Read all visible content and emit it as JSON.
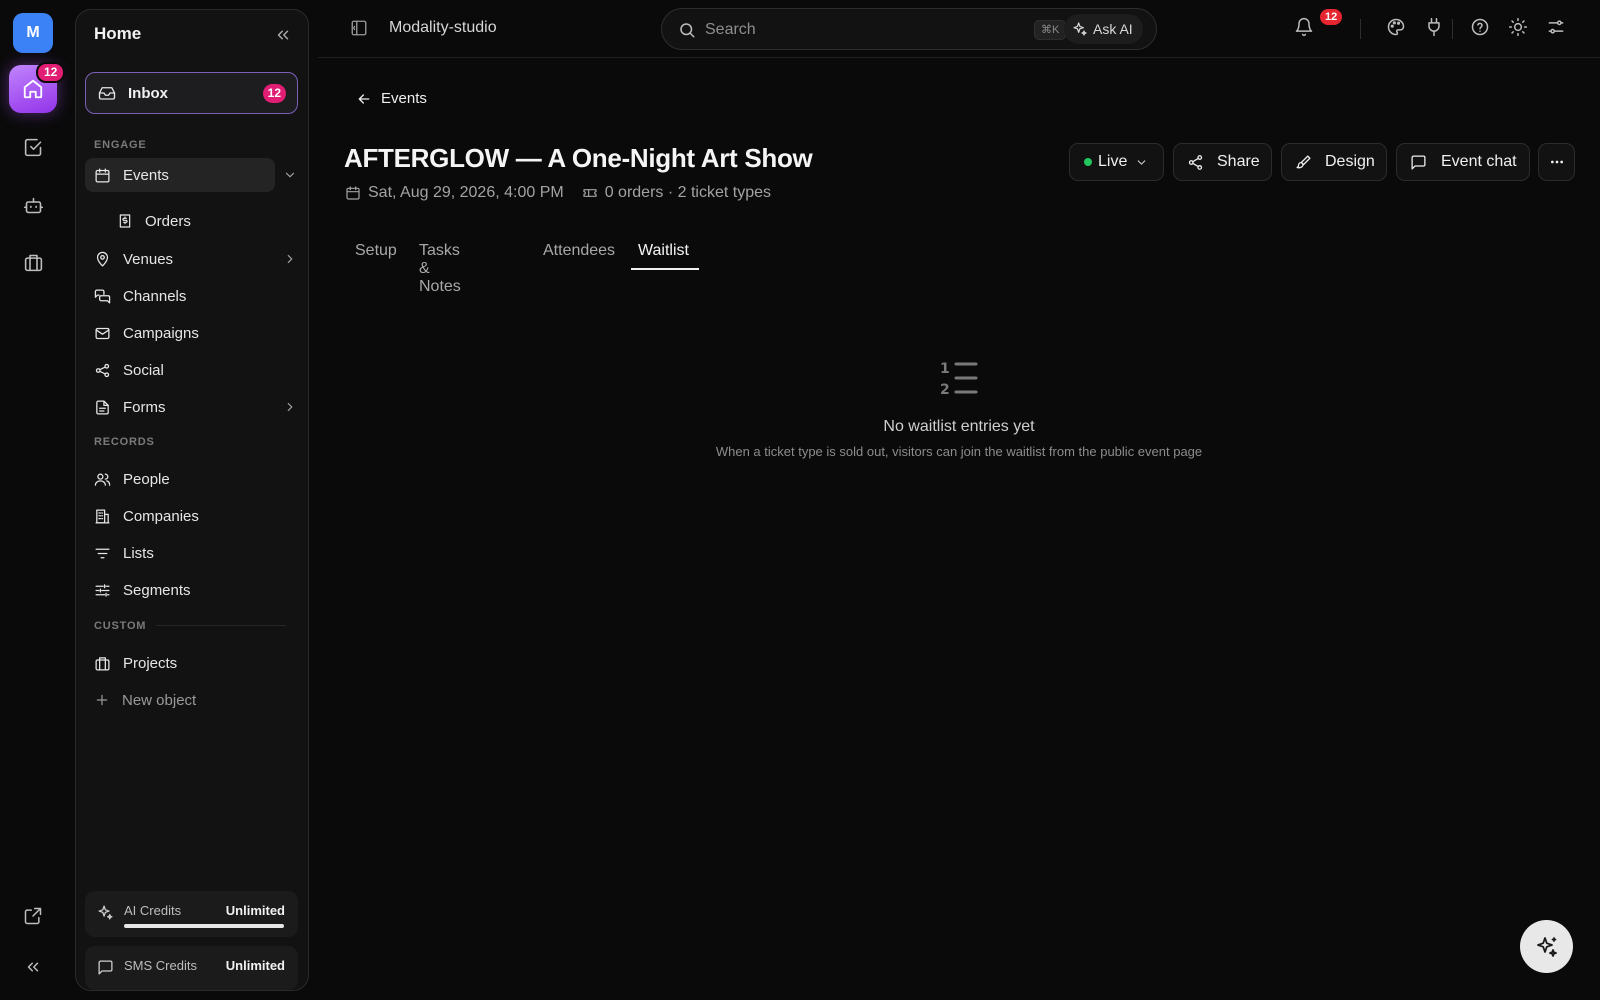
{
  "rail": {
    "avatar_letter": "M",
    "home_badge": "12"
  },
  "sidebar": {
    "title": "Home",
    "inbox": {
      "label": "Inbox",
      "count": "12"
    },
    "sections": {
      "engage": "ENGAGE",
      "records": "RECORDS",
      "custom": "CUSTOM"
    },
    "engage_items": {
      "events": "Events",
      "orders": "Orders",
      "venues": "Venues",
      "channels": "Channels",
      "campaigns": "Campaigns",
      "social": "Social",
      "forms": "Forms"
    },
    "records_items": {
      "people": "People",
      "companies": "Companies",
      "lists": "Lists",
      "segments": "Segments"
    },
    "custom_items": {
      "projects": "Projects",
      "new_object": "New object"
    },
    "credits": {
      "ai_label": "AI Credits",
      "ai_value": "Unlimited",
      "ai_fill": 1.0,
      "sms_label": "SMS Credits",
      "sms_value": "Unlimited"
    }
  },
  "topbar": {
    "workspace": "Modality-studio",
    "search_placeholder": "Search",
    "shortcut": "⌘K",
    "ask_ai": "Ask AI",
    "notification_count": "12"
  },
  "main": {
    "back_label": "Events",
    "title": "AFTERGLOW — A One-Night Art Show",
    "date": "Sat, Aug 29, 2026, 4:00 PM",
    "orders_summary": "0 orders · 2 ticket types",
    "actions": {
      "status": "Live",
      "share": "Share",
      "design": "Design",
      "event_chat": "Event chat"
    },
    "tabs": [
      "Setup",
      "Tasks & Notes",
      "Attendees",
      "Waitlist"
    ],
    "active_tab": "Waitlist",
    "empty": {
      "title": "No waitlist entries yet",
      "subtitle": "When a ticket type is sold out, visitors can join the waitlist from the public event page"
    }
  },
  "colors": {
    "accent": "#9333ea",
    "badge": "#e11d74",
    "live": "#22c55e",
    "background": "#0a0a0a"
  }
}
